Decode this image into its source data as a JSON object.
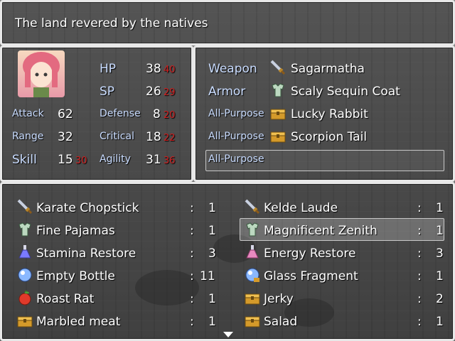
{
  "help": {
    "text": "The land revered by the natives"
  },
  "status": {
    "hp_label": "HP",
    "hp": "38",
    "hp_new": "40",
    "sp_label": "SP",
    "sp": "26",
    "sp_new": "29",
    "attack_label": "Attack",
    "attack": "62",
    "defense_label": "Defense",
    "defense": "8",
    "defense_new": "20",
    "range_label": "Range",
    "range": "32",
    "critical_label": "Critical",
    "critical": "18",
    "critical_new": "22",
    "skill_label": "Skill",
    "skill": "15",
    "skill_new": "30",
    "agility_label": "Agility",
    "agility": "31",
    "agility_new": "36"
  },
  "equip": [
    {
      "slot": "Weapon",
      "item": "Sagarmatha",
      "icon": "sword-icon"
    },
    {
      "slot": "Armor",
      "item": "Scaly Sequin Coat",
      "icon": "armor-icon"
    },
    {
      "slot": "All-Purpose",
      "item": "Lucky Rabbit",
      "icon": "chest-icon"
    },
    {
      "slot": "All-Purpose",
      "item": "Scorpion Tail",
      "icon": "chest-icon"
    },
    {
      "slot": "All-Purpose",
      "item": "",
      "icon": ""
    }
  ],
  "items": [
    {
      "name": "Karate Chopstick",
      "qty": "1",
      "icon": "sword-icon"
    },
    {
      "name": "Kelde Laude",
      "qty": "1",
      "icon": "sword-icon"
    },
    {
      "name": "Fine Pajamas",
      "qty": "1",
      "icon": "armor-icon"
    },
    {
      "name": "Magnificent Zenith",
      "qty": "1",
      "icon": "armor-icon"
    },
    {
      "name": "Stamina Restore",
      "qty": "3",
      "icon": "potion-icon"
    },
    {
      "name": "Energy Restore",
      "qty": "3",
      "icon": "potion-icon"
    },
    {
      "name": "Empty Bottle",
      "qty": "11",
      "icon": "orb-icon"
    },
    {
      "name": "Glass Fragment",
      "qty": "1",
      "icon": "orb-icon"
    },
    {
      "name": "Roast Rat",
      "qty": "1",
      "icon": "apple-icon"
    },
    {
      "name": "Jerky",
      "qty": "2",
      "icon": "chest-icon"
    },
    {
      "name": "Marbled meat",
      "qty": "1",
      "icon": "chest-icon"
    },
    {
      "name": "Salad",
      "qty": "1",
      "icon": "chest-icon"
    }
  ],
  "colon": ":"
}
